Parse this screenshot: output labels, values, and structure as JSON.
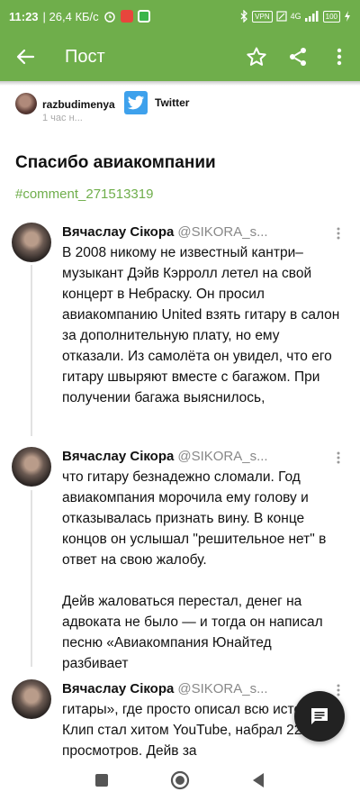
{
  "statusbar": {
    "time": "11:23",
    "speed": "| 26,4 КБ/с",
    "vpn": "VPN",
    "network": "4G",
    "battery": "100"
  },
  "appbar": {
    "title": "Пост",
    "icons": [
      "back-arrow-icon",
      "star-icon",
      "share-icon",
      "more-vert-icon"
    ]
  },
  "post": {
    "author": "razbudimenya",
    "time": "1 час н...",
    "source": "Twitter",
    "title": "Спасибо авиакомпании",
    "hashtag": "#comment_271513319"
  },
  "tweets": [
    {
      "name": "Вячаслау Сікора",
      "handle": "@SIKORA_s...",
      "text": "В 2008 никому не известный кантри–музыкант Дэйв Кэрролл летел на свой концерт в Небраску. Он просил авиакомпанию United взять гитару в салон за дополнительную плату, но ему отказали. Из самолёта он увидел, что его гитару швыряют вместе с багажом. При получении багажа выяснилось,"
    },
    {
      "name": "Вячаслау Сікора",
      "handle": "@SIKORA_s...",
      "text": "что гитару безнадежно сломали. Год авиакомпания морочила ему голову и отказывалась признать вину. В конце концов он услышал \"решительное нет\" в ответ на свою жалобу.\n\nДейв жаловаться перестал, денег на адвоката не было — и тогда он написал песню «Авиакомпания Юнайтед разбивает"
    },
    {
      "name": "Вячаслау Сікора",
      "handle": "@SIKORA_s...",
      "text": "гитары», где просто описал всю историю. Клип стал хитом YouTube, набрал 22М просмотров. Дейв за"
    }
  ],
  "colors": {
    "accent": "#6fae4b",
    "twitter": "#3ea1ec",
    "fab": "#222222"
  }
}
